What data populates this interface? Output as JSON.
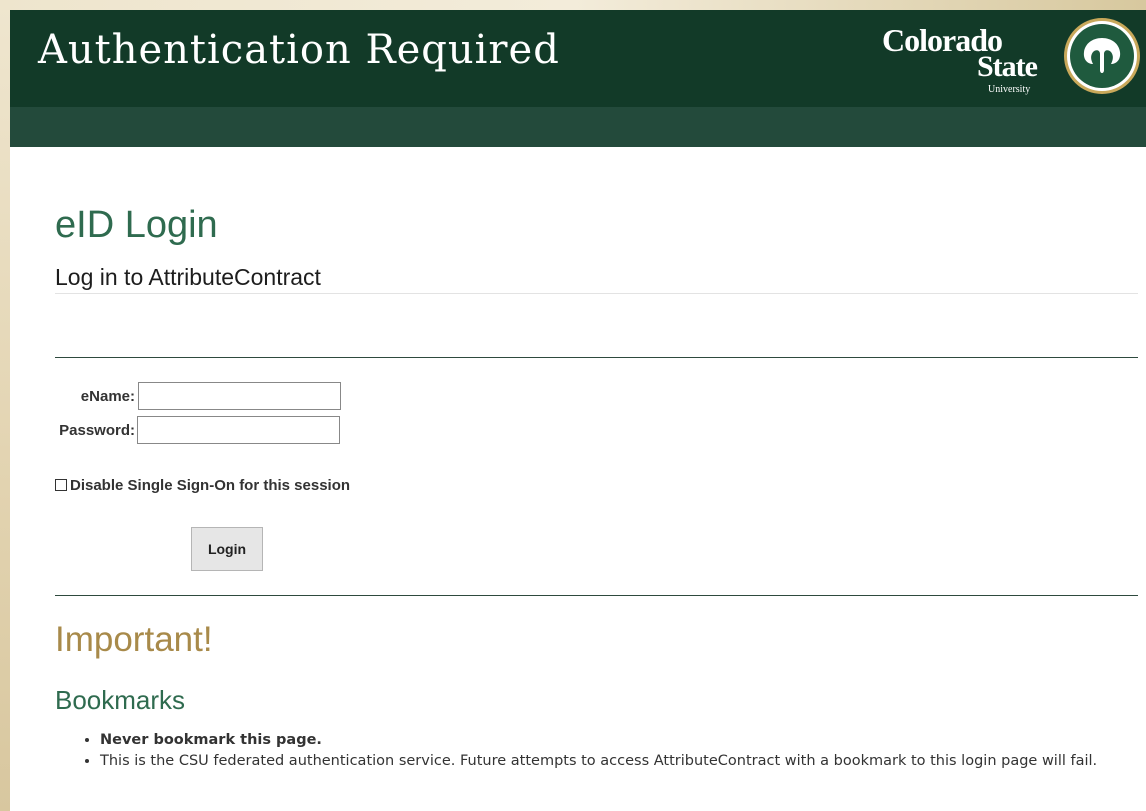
{
  "header": {
    "title": "Authentication Required",
    "logo": {
      "line1": "Colorado",
      "line2": "State",
      "line3": "University",
      "emblem": "ram-seal-icon"
    }
  },
  "login": {
    "heading": "eID Login",
    "subheading": "Log in to AttributeContract",
    "ename_label": "eName:",
    "ename_value": "",
    "password_label": "Password:",
    "password_value": "",
    "sso_checkbox_label": "Disable Single Sign-On for this session",
    "sso_checked": false,
    "login_button": "Login"
  },
  "info": {
    "important_heading": "Important!",
    "bookmarks_heading": "Bookmarks",
    "notes": [
      "Never bookmark this page.",
      "This is the CSU federated authentication service. Future attempts to access AttributeContract with a bookmark to this login page will fail."
    ]
  },
  "colors": {
    "header_bg": "#123a28",
    "subbar_bg": "#234a3b",
    "heading_green": "#2f6b4f",
    "important_gold": "#a88a4a",
    "page_bg": "#e8dcc0"
  }
}
